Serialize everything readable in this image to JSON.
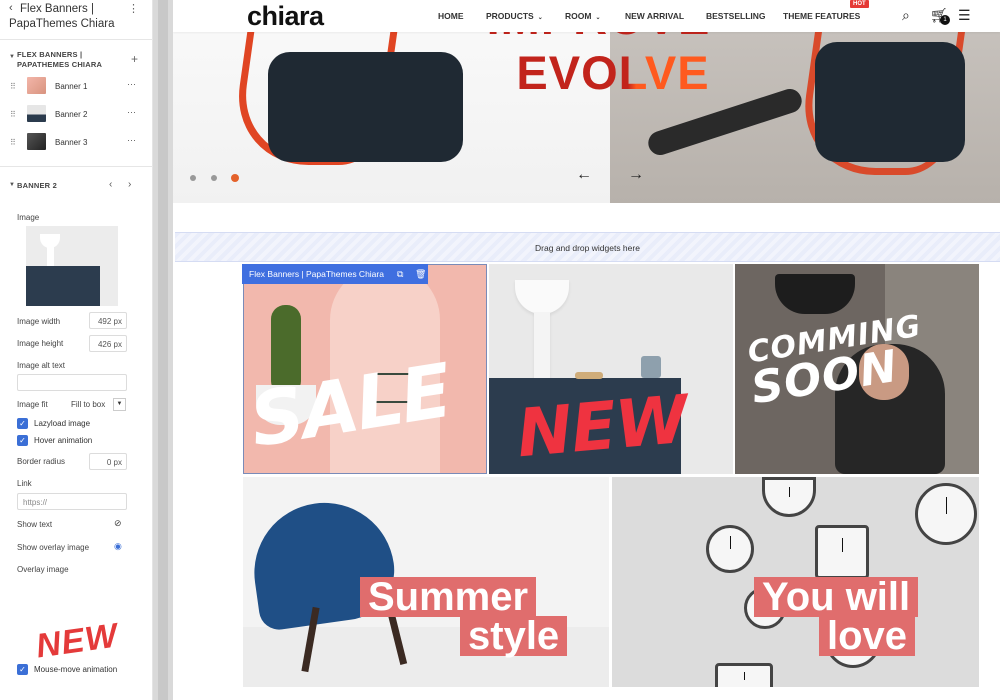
{
  "sidebar": {
    "header_title_line1": "Flex Banners |",
    "header_title_line2": "PapaThemes Chiara",
    "back_icon": "chevron-left-icon",
    "more_icon": "vertical-dots-icon",
    "section1_title_line1": "FLEX BANNERS |",
    "section1_title_line2": "PAPATHEMES CHIARA",
    "items": [
      {
        "label": "Banner 1"
      },
      {
        "label": "Banner 2"
      },
      {
        "label": "Banner 3"
      }
    ],
    "section2_title": "BANNER 2",
    "fields": {
      "image_label": "Image",
      "image_width_label": "Image width",
      "image_width_value": "492 px",
      "image_height_label": "Image height",
      "image_height_value": "426 px",
      "alt_text_label": "Image alt text",
      "alt_text_value": "",
      "fit_label": "Image fit",
      "fit_value": "Fill to box",
      "lazyload_label": "Lazyload image",
      "lazyload_checked": true,
      "hover_label": "Hover animation",
      "hover_checked": true,
      "border_radius_label": "Border radius",
      "border_radius_value": "0 px",
      "link_label": "Link",
      "link_placeholder": "https://",
      "show_text_label": "Show text",
      "show_overlay_label": "Show overlay image",
      "overlay_label": "Overlay image",
      "mouse_move_label": "Mouse-move animation",
      "mouse_move_checked": true
    },
    "new_badge": "NEW"
  },
  "nav": {
    "logo": "chiara",
    "menu": [
      {
        "label": "HOME",
        "dropdown": false
      },
      {
        "label": "PRODUCTS",
        "dropdown": true
      },
      {
        "label": "ROOM",
        "dropdown": true
      },
      {
        "label": "NEW ARRIVAL",
        "dropdown": false
      },
      {
        "label": "BESTSELLING",
        "dropdown": false
      },
      {
        "label": "THEME FEATURES",
        "dropdown": false
      }
    ],
    "hot_badge": "HOT",
    "cart_count": "1"
  },
  "hero": {
    "line1": "IMPROVE",
    "line2": "EVOLVE",
    "prev_arrow": "←",
    "next_arrow": "→",
    "active_dot": 3,
    "total_dots": 3
  },
  "dropzone_text": "Drag and drop widgets here",
  "widget_toolbar": {
    "title": "Flex Banners | PapaThemes Chiara",
    "icons": [
      "copy-icon",
      "trash-icon"
    ]
  },
  "banners": [
    {
      "name": "banner-sale",
      "text": "SALE"
    },
    {
      "name": "banner-new",
      "text": "NEW"
    },
    {
      "name": "banner-coming-soon",
      "text_line1": "COMMING",
      "text_line2": "SOON"
    },
    {
      "name": "banner-summer",
      "text_line1": "Summer",
      "text_line2": "style"
    },
    {
      "name": "banner-love",
      "text_line1": "You will",
      "text_line2": "love"
    }
  ],
  "colors": {
    "accent_blue": "#3f6fe0",
    "hero_red": "#c2241c",
    "hero_orange": "#ff5a1f",
    "tag_pink": "#e06d6d",
    "new_red": "#ef3340"
  }
}
